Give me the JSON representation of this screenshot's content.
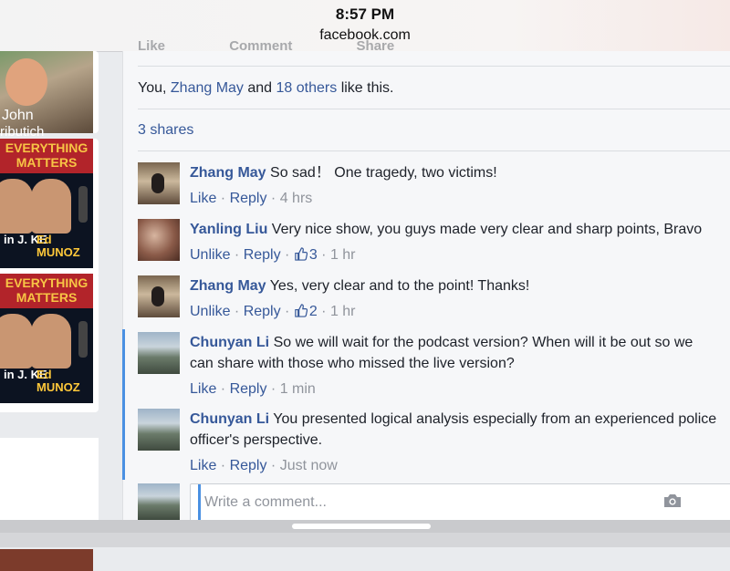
{
  "status_bar": {
    "time": "8:57 PM",
    "url": "facebook.com"
  },
  "left_column": {
    "profile_name_line1": "John",
    "profile_name_line2": "ributich",
    "video1": {
      "banner": "EVERYTHING MATTERS",
      "host_left": "in J. KE",
      "host_right": "Ed MUNOZ"
    },
    "video2": {
      "banner": "EVERYTHING MATTERS",
      "host_left": "in J. KE",
      "host_right": "Ed MUNOZ"
    }
  },
  "post": {
    "actions": [
      "Like",
      "Comment",
      "Share"
    ],
    "likes_prefix": "You, ",
    "likes_name": "Zhang May",
    "likes_and": " and ",
    "likes_others": "18 others",
    "likes_suffix": " like this.",
    "shares": "3 shares"
  },
  "comments": [
    {
      "name": "Zhang May",
      "text": "So sad！ One tragedy, two victims!",
      "like_label": "Like",
      "reply_label": "Reply",
      "likes": "",
      "time": "4 hrs"
    },
    {
      "name": "Yanling Liu",
      "text": "Very nice show, you guys made very clear and sharp points, Bravo",
      "like_label": "Unlike",
      "reply_label": "Reply",
      "likes": "3",
      "time": "1 hr"
    },
    {
      "name": "Zhang May",
      "text": "Yes, very clear and to the point! Thanks!",
      "like_label": "Unlike",
      "reply_label": "Reply",
      "likes": "2",
      "time": "1 hr"
    },
    {
      "name": "Chunyan Li",
      "text": "So we will wait for the podcast version? When will it be out so we can share with those who missed the live version?",
      "like_label": "Like",
      "reply_label": "Reply",
      "likes": "",
      "time": "1 min"
    },
    {
      "name": "Chunyan Li",
      "text": "You presented logical analysis especially from an experienced police officer's perspective.",
      "like_label": "Like",
      "reply_label": "Reply",
      "likes": "",
      "time": "Just now"
    }
  ],
  "composer": {
    "placeholder": "Write a comment..."
  },
  "colors": {
    "link": "#365899",
    "meta": "#90949c",
    "thread_accent": "#4a90e2"
  },
  "icons": {
    "camera": "camera-icon",
    "like": "thumbs-up-icon"
  }
}
